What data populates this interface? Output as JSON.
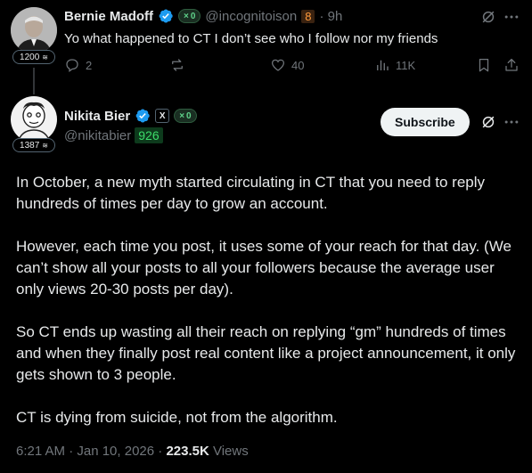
{
  "first_post": {
    "name": "Bernie Madoff",
    "ct_score": "0",
    "handle": "@incognitoison",
    "badge_number": "8",
    "time": "· 9h",
    "text": "Yo what happened to CT I don’t see who I follow nor my friends",
    "user_score": "1200",
    "actions": {
      "replies": "2",
      "reposts": "",
      "likes": "40",
      "views": "11K"
    }
  },
  "main_post": {
    "name": "Nikita Bier",
    "ct_score": "0",
    "handle": "@nikitabier",
    "badge_number": "926",
    "user_score": "1387",
    "subscribe_label": "Subscribe",
    "paragraphs": [
      "In October, a new myth started circulating in CT that you need to reply hundreds of times per day to grow an account.",
      "However, each time you post, it uses some of your reach for that day. (We can’t show all your posts to all your followers because the average user only views 20-30 posts per day).",
      "So CT ends up wasting all their reach on replying “gm” hundreds of times and when they finally post real content like a project announcement, it only gets shown to 3 people.",
      "CT is dying from suicide, not from the algorithm."
    ],
    "timestamp": "6:21 AM · Jan 10, 2026 · ",
    "views_count": "223.5K",
    "views_label": " Views"
  },
  "colors": {
    "background": "#000000",
    "verified_blue": "#1d9bf0",
    "muted": "#71767b",
    "text": "#e7e9ea"
  }
}
